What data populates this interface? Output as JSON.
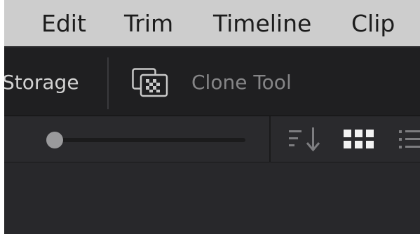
{
  "menubar": {
    "items": [
      "Edit",
      "Trim",
      "Timeline",
      "Clip"
    ]
  },
  "toolbar": {
    "storage_label": "Storage",
    "clone_tool_label": "Clone Tool",
    "clone_icon": "clone-tool-icon"
  },
  "filterbar": {
    "thumbnail_size_slider": 0.05,
    "sort_icon": "sort-descending-icon",
    "grid_view_icon": "grid-view-icon",
    "list_view_icon": "list-view-icon"
  },
  "colors": {
    "menubar_bg": "#cdcdcd",
    "toolbar_bg": "#1f1f21",
    "panel_bg": "#28282b",
    "text_active": "#d2d2d2",
    "text_dim": "#858587"
  }
}
